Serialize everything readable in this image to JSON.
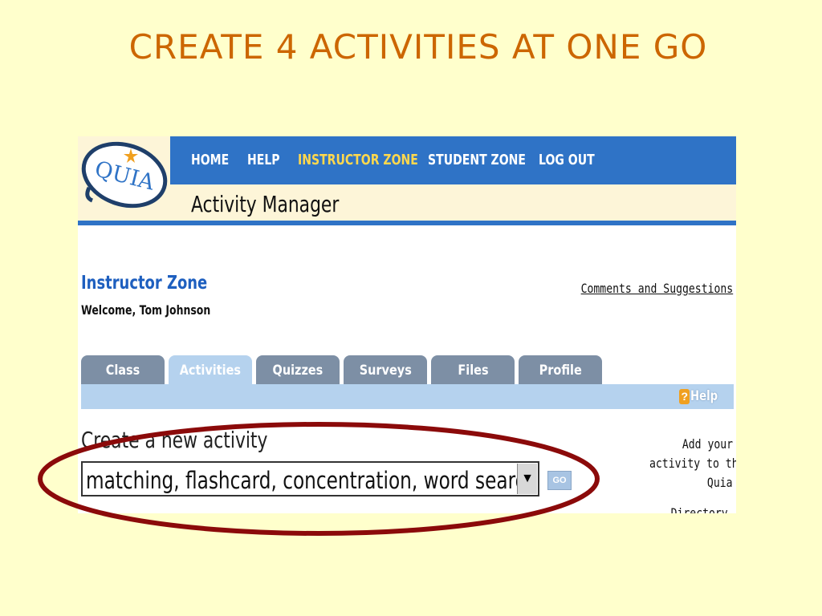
{
  "slide": {
    "title": "CREATE 4 ACTIVITIES AT ONE GO"
  },
  "header": {
    "logo_text": "QUIA",
    "nav": [
      "HOME",
      "HELP",
      "INSTRUCTOR ZONE",
      "STUDENT ZONE",
      "LOG OUT"
    ],
    "active_nav": "INSTRUCTOR ZONE",
    "section_title": "Activity Manager"
  },
  "zone": {
    "title": "Instructor Zone",
    "welcome": "Welcome, Tom Johnson",
    "comments_link": "Comments and Suggestions"
  },
  "tabs": [
    {
      "label": "Class",
      "active": false
    },
    {
      "label": "Activities",
      "active": true
    },
    {
      "label": "Quizzes",
      "active": false
    },
    {
      "label": "Surveys",
      "active": false
    },
    {
      "label": "Files",
      "active": false
    },
    {
      "label": "Profile",
      "active": false
    }
  ],
  "help_label": "Help",
  "create": {
    "label": "Create a new activity",
    "selected": "matching, flashcard, concentration, word search",
    "go_label": "GO",
    "add_link_lines": [
      "Add your",
      "activity to the",
      "Quia"
    ],
    "directory_partial": "Directory"
  },
  "colors": {
    "title": "#cc6600",
    "background": "#ffffcc",
    "nav_bar": "#2f73c6",
    "active_nav": "#ffd84d",
    "tab": "#7d8fa5",
    "active_tab": "#b5d2ee",
    "highlight": "#8b0a0a"
  }
}
